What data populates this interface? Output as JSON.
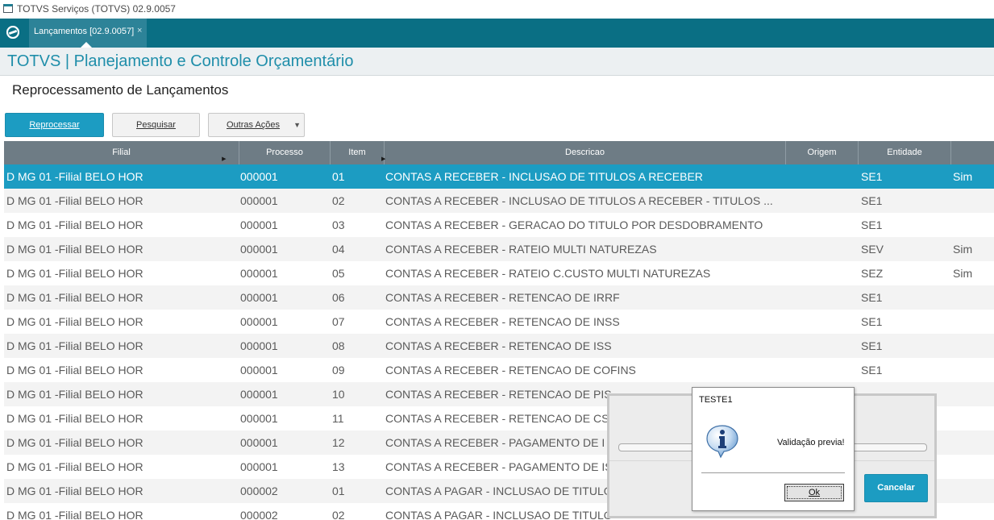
{
  "window": {
    "title": "TOTVS Serviços (TOTVS) 02.9.0057"
  },
  "tabs": [
    {
      "label": "Lançamentos [02.9.0057]",
      "close": "×"
    }
  ],
  "module": {
    "title": "TOTVS | Planejamento e Controle Orçamentário"
  },
  "page": {
    "title": "Reprocessamento de Lançamentos"
  },
  "toolbar": {
    "reprocessar": "Reprocessar",
    "pesquisar": "Pesquisar",
    "outras_acoes": "Outras Ações"
  },
  "grid": {
    "columns": [
      "Filial",
      "Processo",
      "Item",
      "Descricao",
      "Origem",
      "Entidade",
      ""
    ],
    "rows": [
      [
        "D MG 01 -Filial BELO HOR",
        "000001",
        "01",
        "CONTAS A RECEBER - INCLUSAO DE TITULOS A RECEBER",
        "",
        "SE1",
        "Sim"
      ],
      [
        "D MG 01 -Filial BELO HOR",
        "000001",
        "02",
        "CONTAS A RECEBER - INCLUSAO DE TITULOS A RECEBER - TITULOS ...",
        "",
        "SE1",
        ""
      ],
      [
        "D MG 01 -Filial BELO HOR",
        "000001",
        "03",
        "CONTAS A RECEBER - GERACAO DO TITULO POR DESDOBRAMENTO",
        "",
        "SE1",
        ""
      ],
      [
        "D MG 01 -Filial BELO HOR",
        "000001",
        "04",
        "CONTAS A RECEBER - RATEIO MULTI NATUREZAS",
        "",
        "SEV",
        "Sim"
      ],
      [
        "D MG 01 -Filial BELO HOR",
        "000001",
        "05",
        "CONTAS A RECEBER - RATEIO C.CUSTO MULTI NATUREZAS",
        "",
        "SEZ",
        "Sim"
      ],
      [
        "D MG 01 -Filial BELO HOR",
        "000001",
        "06",
        "CONTAS A RECEBER - RETENCAO DE IRRF",
        "",
        "SE1",
        ""
      ],
      [
        "D MG 01 -Filial BELO HOR",
        "000001",
        "07",
        "CONTAS A RECEBER - RETENCAO DE INSS",
        "",
        "SE1",
        ""
      ],
      [
        "D MG 01 -Filial BELO HOR",
        "000001",
        "08",
        "CONTAS A RECEBER - RETENCAO DE ISS",
        "",
        "SE1",
        ""
      ],
      [
        "D MG 01 -Filial BELO HOR",
        "000001",
        "09",
        "CONTAS A RECEBER - RETENCAO DE COFINS",
        "",
        "SE1",
        ""
      ],
      [
        "D MG 01 -Filial BELO HOR",
        "000001",
        "10",
        "CONTAS A RECEBER - RETENCAO DE PIS",
        "",
        "",
        ""
      ],
      [
        "D MG 01 -Filial BELO HOR",
        "000001",
        "11",
        "CONTAS A RECEBER - RETENCAO DE CS",
        "",
        "",
        ""
      ],
      [
        "D MG 01 -Filial BELO HOR",
        "000001",
        "12",
        "CONTAS A RECEBER - PAGAMENTO DE I",
        "",
        "",
        ""
      ],
      [
        "D MG 01 -Filial BELO HOR",
        "000001",
        "13",
        "CONTAS A RECEBER - PAGAMENTO DE IS",
        "",
        "",
        ""
      ],
      [
        "D MG 01 -Filial BELO HOR",
        "000002",
        "01",
        "CONTAS A PAGAR - INCLUSAO DE TITULO",
        "",
        "",
        ""
      ],
      [
        "D MG 01 -Filial BELO HOR",
        "000002",
        "02",
        "CONTAS A PAGAR - INCLUSAO DE TITULO",
        "",
        "",
        ""
      ]
    ],
    "selected_row": 0
  },
  "progress_dialog": {
    "cancel": "Cancelar"
  },
  "message_box": {
    "title": "TESTE1",
    "icon": "info-icon",
    "text": "Validação previa!",
    "ok": "Ok"
  },
  "colors": {
    "accent": "#1c9cc2",
    "tabbar": "#0a6f84",
    "header": "#6e7c85"
  }
}
